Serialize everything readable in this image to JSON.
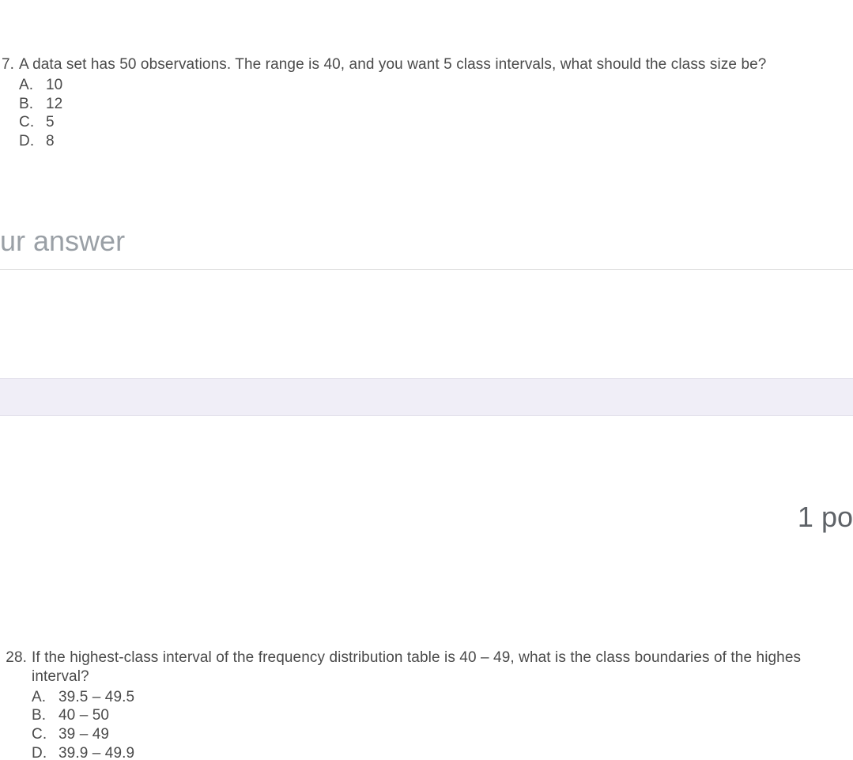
{
  "q1": {
    "number": "7.",
    "text": "A data set has 50 observations. The range is 40, and you want 5 class intervals, what should the class size be?",
    "options": {
      "A": {
        "letter": "A.",
        "value": "10"
      },
      "B": {
        "letter": "B.",
        "value": "12"
      },
      "C": {
        "letter": "C.",
        "value": "5"
      },
      "D": {
        "letter": "D.",
        "value": "8"
      }
    }
  },
  "answer_placeholder": "ur answer",
  "points_partial": "1 po",
  "q2": {
    "number": "28.",
    "text_line1": "If the highest-class interval of the frequency distribution table is 40 – 49, what is the class boundaries of the highes",
    "text_line2": "interval?",
    "options": {
      "A": {
        "letter": "A.",
        "value": "39.5 – 49.5"
      },
      "B": {
        "letter": "B.",
        "value": "40 – 50"
      },
      "C": {
        "letter": "C.",
        "value": "39 – 49"
      },
      "D": {
        "letter": "D.",
        "value": "39.9 – 49.9"
      }
    }
  }
}
